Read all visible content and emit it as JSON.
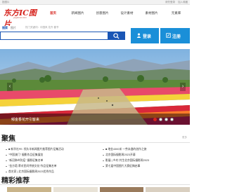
{
  "topbar": {
    "left_text": "投图片",
    "right_links": [
      "请先登录",
      "加入收藏"
    ]
  },
  "logo": {
    "mark": "东方IC图片",
    "url": "yogomoo.com"
  },
  "nav": {
    "items": [
      "首页",
      "新闻图片",
      "创意图片",
      "设计素材",
      "素材图片",
      "元素库"
    ],
    "active_index": 0
  },
  "search": {
    "tabs": [
      "搜索",
      "图片"
    ],
    "hot_words": "热门关键词：中国风 花卉 春节",
    "placeholder": "",
    "login_label": "登录",
    "register_label": "注册"
  },
  "hero": {
    "caption": "郁金香花开引客来",
    "arrow_left": "‹",
    "arrow_right": "›",
    "slides": 4,
    "active_slide": 0
  },
  "focus": {
    "title": "聚焦",
    "more": "更多",
    "left_items": [
      "■ 新华社FE: 领头羊新闻图片推荐图片征集活动",
      "\"中国澳门\" 摄影作品征集展览",
      "\"新冠肺炎防疫\" 摄影征集名单",
      "\"金方塔·蒂对民间传统文化\"作品征集名单",
      "首艺家 | 北京国际摄影周2023优秀作品"
    ],
    "right_items": [
      "■ 地金4300米 一劳永逸的创作之旅",
      "北京国际摄影周2023开幕",
      "影展 | 乡村·共生北京国际摄影周2023",
      "第七届中国图片大赛征稿启事"
    ]
  },
  "recommend": {
    "title": "精彩推荐"
  },
  "colors": {
    "brand_red": "#d6231d",
    "blue": "#1a56b5",
    "login_blue": "#1a8fd8"
  }
}
